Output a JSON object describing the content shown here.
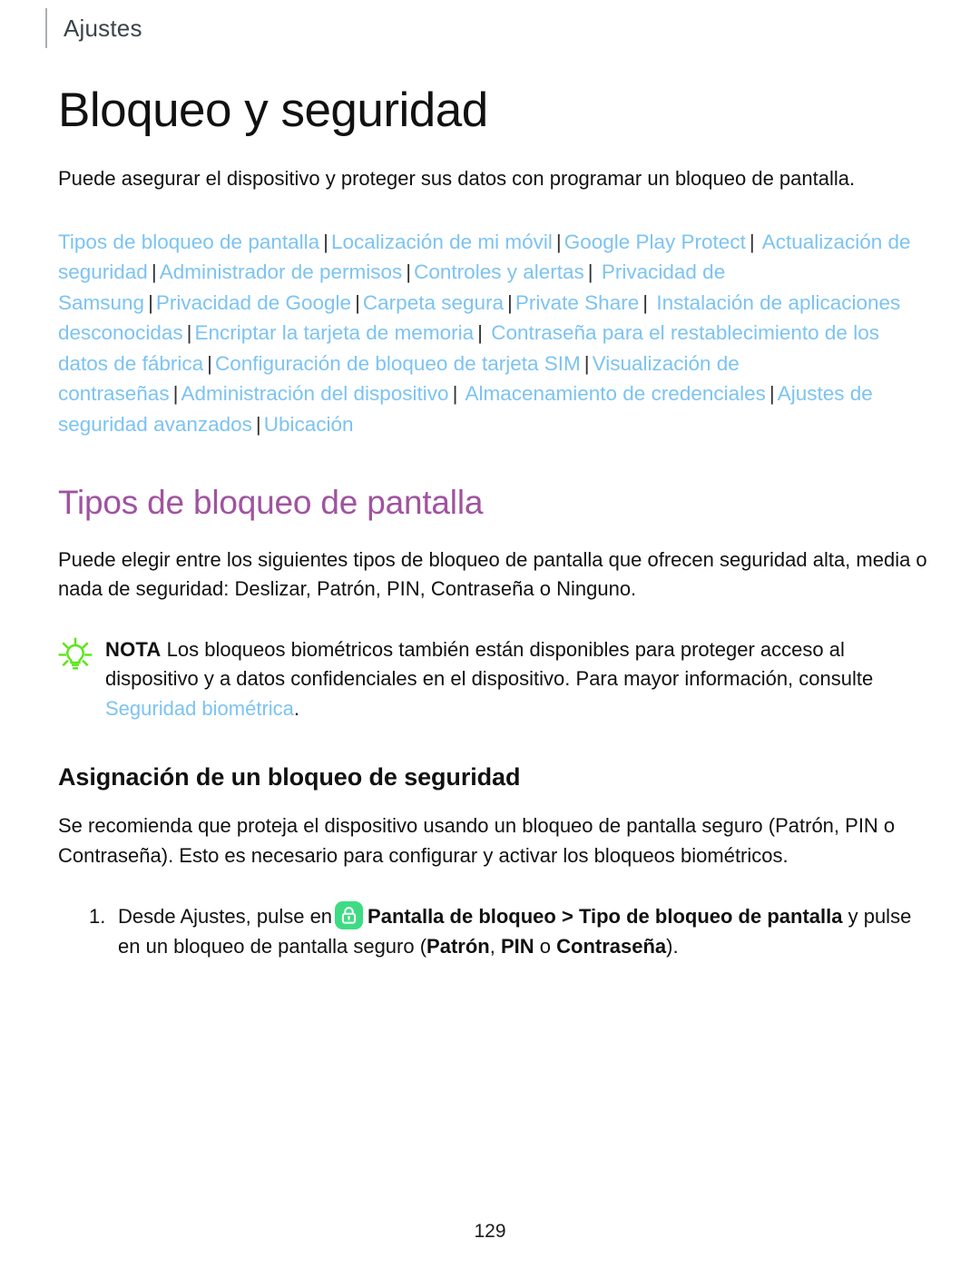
{
  "header": {
    "title": "Ajustes"
  },
  "doc": {
    "title": "Bloqueo y seguridad",
    "intro": "Puede asegurar el dispositivo y proteger sus datos con programar un bloqueo de pantalla."
  },
  "link_index": {
    "separator": "|",
    "links": [
      "Tipos de bloqueo de pantalla",
      "Localización de mi móvil",
      "Google Play Protect",
      "Actualización de seguridad",
      "Administrador de permisos",
      "Controles y alertas",
      "Privacidad de Samsung",
      "Privacidad de Google",
      "Carpeta segura",
      "Private Share",
      "Instalación de aplicaciones desconocidas",
      "Encriptar la tarjeta de memoria",
      "Contraseña para el restablecimiento de los datos de fábrica",
      "Configuración de bloqueo de tarjeta SIM",
      "Visualización de contraseñas",
      "Administración del dispositivo",
      "Almacenamiento de credenciales",
      "Ajustes de seguridad avanzados",
      "Ubicación"
    ]
  },
  "section": {
    "title": "Tipos de bloqueo de pantalla",
    "paragraph": "Puede elegir entre los siguientes tipos de bloqueo de pantalla que ofrecen seguridad alta, media o nada de seguridad: Deslizar, Patrón, PIN, Contraseña o Ninguno."
  },
  "note": {
    "icon": "lightbulb-icon",
    "label": "NOTA",
    "text_before": "Los bloqueos biométricos también están disponibles para proteger acceso al dispositivo y a datos confidenciales en el dispositivo. Para mayor información, consulte ",
    "link": "Seguridad biométrica",
    "text_after": "."
  },
  "subsection": {
    "title": "Asignación de un bloqueo de seguridad",
    "paragraph": "Se recomienda que proteja el dispositivo usando un bloqueo de pantalla seguro (Patrón, PIN o Contraseña). Esto es necesario para configurar y activar los bloqueos biométricos."
  },
  "step": {
    "number": "1.",
    "part1": "Desde Ajustes, pulse en",
    "icon": "lock-icon",
    "bold1": "Pantalla de bloqueo",
    "chevron": ">",
    "bold2": "Tipo de bloqueo de pantalla",
    "part2": " y pulse en un bloqueo de pantalla seguro (",
    "bold3": "Patrón",
    "comma": ", ",
    "bold4": "PIN",
    "or": " o ",
    "bold5": "Contraseña",
    "part3": ")."
  },
  "footer": {
    "page_number": "129"
  },
  "colors": {
    "link_blue": "#7cc3f2",
    "heading_purple": "#a0539f",
    "icon_green": "#3ddc84",
    "bulb_green": "#5ce619",
    "header_gray": "#3b4448"
  }
}
